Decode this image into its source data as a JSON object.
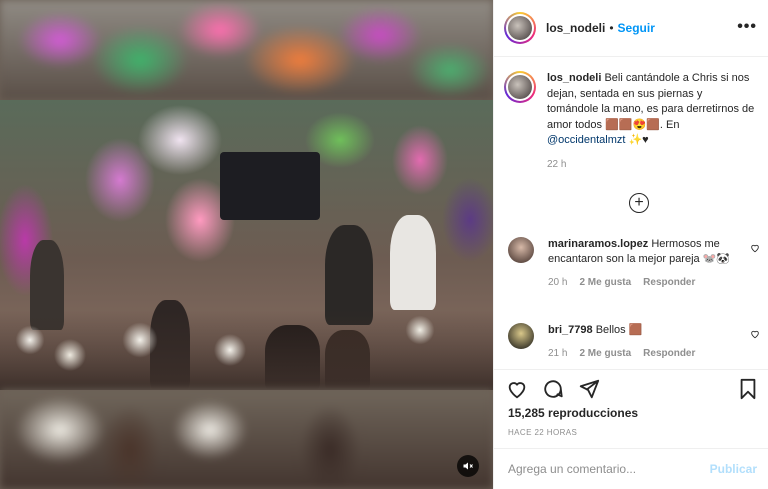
{
  "post": {
    "username": "los_nodeli",
    "follow_label": "Seguir",
    "more_label": "•••",
    "caption": "Beli cantándole a Chris si nos dejan, sentada en sus piernas y tomándole la mano, es para derretirnos de amor todos 🟫🟫😍🟫. En",
    "mention": "@occidentalmzt",
    "caption_tail": " ✨♥",
    "caption_time": "22 h",
    "load_more_icon": "plus-circle-icon",
    "views": "15,285 reproducciones",
    "time_ago": "HACE 22 HORAS"
  },
  "comments": [
    {
      "username": "marinaramos.lopez",
      "text": "Hermosos me encantaron son la mejor pareja 🐭🐼",
      "time": "20 h",
      "likes": "2 Me gusta",
      "reply": "Responder"
    },
    {
      "username": "bri_7798",
      "text": "Bellos 🟫",
      "time": "21 h",
      "likes": "2 Me gusta",
      "reply": "Responder"
    }
  ],
  "composer": {
    "placeholder": "Agrega un comentario...",
    "publish_label": "Publicar"
  },
  "colors": {
    "accent": "#0095f6",
    "publish_disabled": "#b2dffc",
    "muted": "#8e8e8e"
  },
  "icons": [
    "heart-icon",
    "comment-icon",
    "share-icon",
    "bookmark-icon",
    "volume-mute-icon"
  ]
}
